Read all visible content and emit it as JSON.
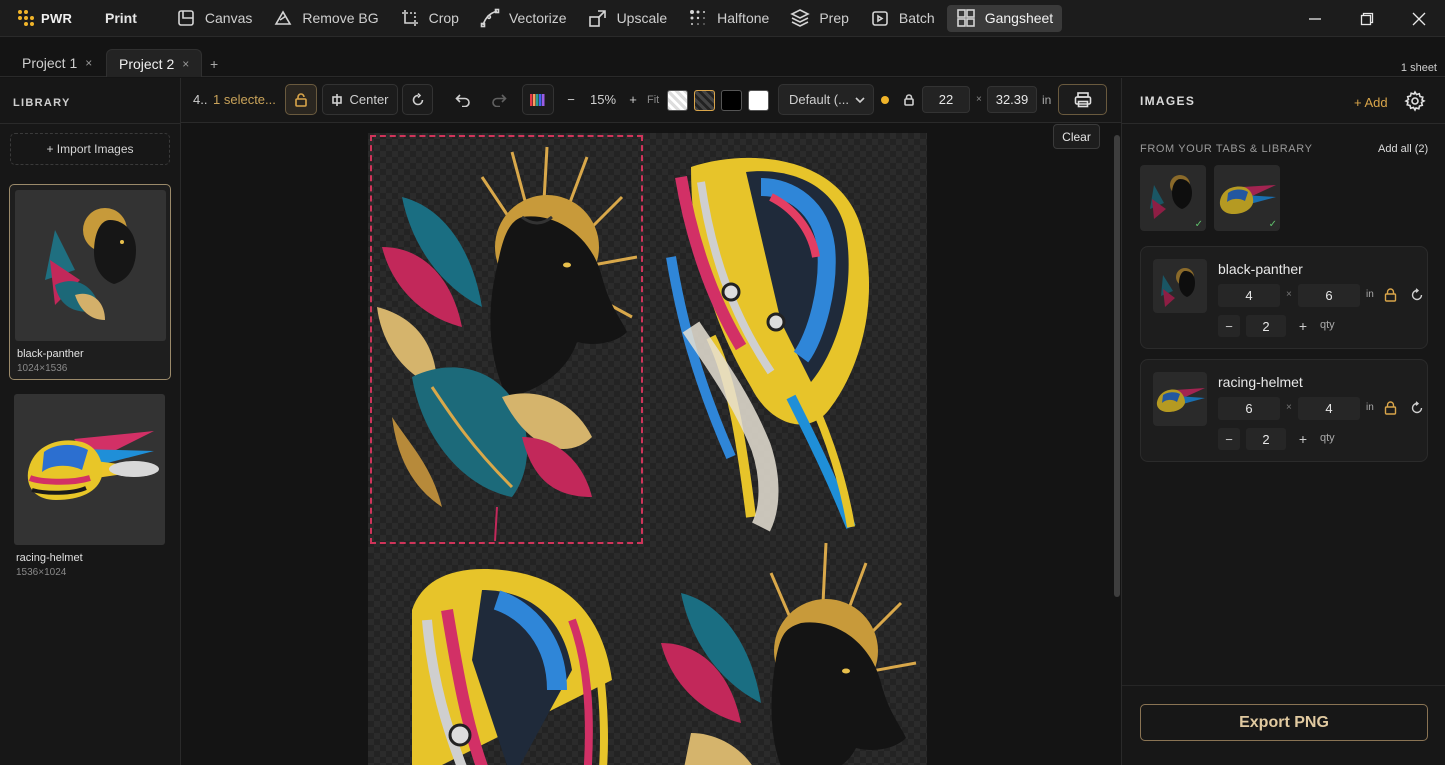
{
  "app": {
    "name": "PWR",
    "print_label": "Print"
  },
  "tools": [
    {
      "label": "Canvas",
      "icon": "canvas-icon"
    },
    {
      "label": "Remove BG",
      "icon": "remove-bg-icon"
    },
    {
      "label": "Crop",
      "icon": "crop-icon"
    },
    {
      "label": "Vectorize",
      "icon": "vectorize-icon"
    },
    {
      "label": "Upscale",
      "icon": "upscale-icon"
    },
    {
      "label": "Halftone",
      "icon": "halftone-icon"
    },
    {
      "label": "Prep",
      "icon": "prep-icon"
    },
    {
      "label": "Batch",
      "icon": "batch-icon"
    },
    {
      "label": "Gangsheet",
      "icon": "gangsheet-icon",
      "active": true
    }
  ],
  "project_tabs": [
    {
      "label": "Project 1",
      "close": "×"
    },
    {
      "label": "Project 2",
      "close": "×",
      "active": true
    }
  ],
  "add_tab": "+",
  "sheet_count": "1 sheet",
  "library": {
    "title": "LIBRARY",
    "import_label": "+ Import Images",
    "items": [
      {
        "name": "black-panther",
        "dims": "1024×1536",
        "selected": true
      },
      {
        "name": "racing-helmet",
        "dims": "1536×1024",
        "selected": false
      }
    ]
  },
  "toolbar": {
    "count_label": "4..",
    "selected_label": "1 selecte...",
    "center_label": "Center",
    "zoom_minus": "−",
    "zoom_value": "15%",
    "zoom_plus": "+",
    "fit_label": "Fit",
    "preset_label": "Default (...",
    "width_value": "22",
    "x_sep": "×",
    "height_value": "32.39",
    "unit": "in",
    "status_color": "#f0b429"
  },
  "tooltip": {
    "label": "Clear"
  },
  "images_panel": {
    "title": "IMAGES",
    "add_label": "+ Add",
    "subtitle": "FROM YOUR TABS & LIBRARY",
    "add_all_label": "Add all (2)",
    "check": "✓",
    "cards": [
      {
        "name": "black-panther",
        "width": "4",
        "height": "6",
        "unit": "in",
        "x_sep": "×",
        "minus": "−",
        "qty": "2",
        "plus": "+",
        "qty_label": "qty"
      },
      {
        "name": "racing-helmet",
        "width": "6",
        "height": "4",
        "unit": "in",
        "x_sep": "×",
        "minus": "−",
        "qty": "2",
        "plus": "+",
        "qty_label": "qty"
      }
    ],
    "export_label": "Export PNG"
  },
  "colors": {
    "accent": "#d9a54a",
    "selection": "#d0345a",
    "export_border": "#8a7454"
  }
}
